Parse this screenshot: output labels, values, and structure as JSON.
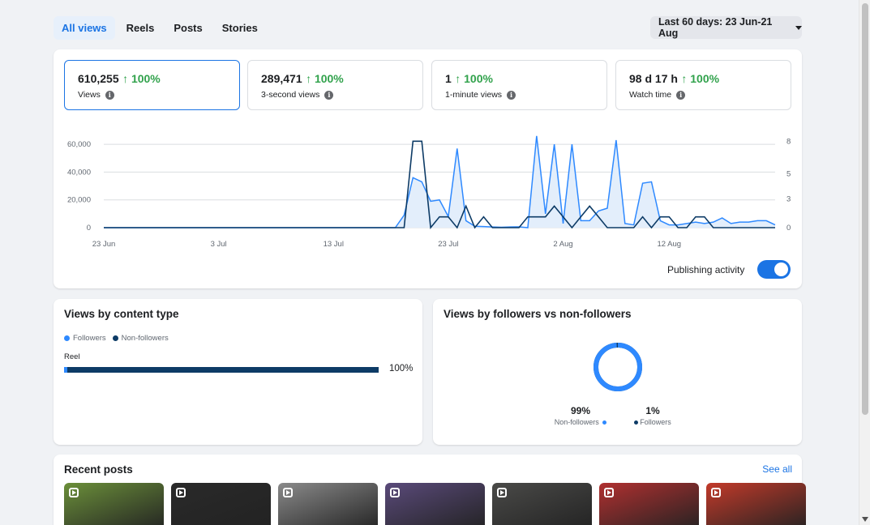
{
  "tabs": [
    {
      "label": "All views",
      "active": true
    },
    {
      "label": "Reels",
      "active": false
    },
    {
      "label": "Posts",
      "active": false
    },
    {
      "label": "Stories",
      "active": false
    }
  ],
  "date_range": "Last 60 days: 23 Jun-21 Aug",
  "metrics": [
    {
      "value": "610,255",
      "change": "↑ 100%",
      "label": "Views",
      "selected": true
    },
    {
      "value": "289,471",
      "change": "↑ 100%",
      "label": "3-second views",
      "selected": false
    },
    {
      "value": "1",
      "change": "↑ 100%",
      "label": "1-minute views",
      "selected": false
    },
    {
      "value": "98 d 17 h",
      "change": "↑ 100%",
      "label": "Watch time",
      "selected": false
    }
  ],
  "colors": {
    "accent": "#1b74e4",
    "positive": "#31a24c",
    "views_line": "#2e89ff",
    "activity_line": "#0d3b66",
    "area_fill": "#e3eefb"
  },
  "publishing_activity": {
    "label": "Publishing activity",
    "enabled": true
  },
  "chart_data": {
    "type": "line",
    "x": [
      "23 Jun",
      "24 Jun",
      "25 Jun",
      "26 Jun",
      "27 Jun",
      "28 Jun",
      "29 Jun",
      "30 Jun",
      "1 Jul",
      "2 Jul",
      "3 Jul",
      "4 Jul",
      "5 Jul",
      "6 Jul",
      "7 Jul",
      "8 Jul",
      "9 Jul",
      "10 Jul",
      "11 Jul",
      "12 Jul",
      "13 Jul",
      "14 Jul",
      "15 Jul",
      "16 Jul",
      "17 Jul",
      "18 Jul",
      "19 Jul",
      "20 Jul",
      "21 Jul",
      "22 Jul",
      "23 Jul",
      "24 Jul",
      "25 Jul",
      "26 Jul",
      "27 Jul",
      "28 Jul",
      "29 Jul",
      "30 Jul",
      "31 Jul",
      "1 Aug",
      "2 Aug",
      "3 Aug",
      "4 Aug",
      "5 Aug",
      "6 Aug",
      "7 Aug",
      "8 Aug",
      "9 Aug",
      "10 Aug",
      "11 Aug",
      "12 Aug",
      "13 Aug",
      "14 Aug",
      "15 Aug",
      "16 Aug",
      "17 Aug",
      "18 Aug",
      "19 Aug",
      "20 Aug",
      "21 Aug"
    ],
    "x_tick_labels": [
      "23 Jun",
      "3 Jul",
      "13 Jul",
      "23 Jul",
      "2 Aug",
      "12 Aug"
    ],
    "series": [
      {
        "name": "Views",
        "axis": "left",
        "values": [
          0,
          0,
          0,
          0,
          0,
          0,
          0,
          0,
          0,
          0,
          0,
          0,
          0,
          0,
          0,
          0,
          0,
          0,
          0,
          0,
          0,
          0,
          0,
          0,
          0,
          0,
          0,
          0,
          0,
          0,
          0,
          0,
          0,
          0,
          9000,
          36000,
          33000,
          19000,
          20000,
          8000,
          57000,
          5000,
          1000,
          800,
          500,
          300,
          500,
          600,
          0,
          66000,
          10000,
          60000,
          3000,
          60000,
          5000,
          5000,
          12000,
          14000,
          63000,
          3000,
          2000,
          32000,
          33000,
          5000,
          2000,
          2000,
          3000,
          4000,
          3000,
          4000,
          7000,
          3000,
          4000,
          4000,
          5000,
          5000,
          2000
        ]
      },
      {
        "name": "Publishing activity",
        "axis": "right",
        "values": [
          0,
          0,
          0,
          0,
          0,
          0,
          0,
          0,
          0,
          0,
          0,
          0,
          0,
          0,
          0,
          0,
          0,
          0,
          0,
          0,
          0,
          0,
          0,
          0,
          0,
          0,
          0,
          0,
          0,
          0,
          0,
          0,
          0,
          0,
          0,
          8,
          8,
          0,
          1,
          1,
          0,
          2,
          0,
          1,
          0,
          0,
          0,
          0,
          1,
          1,
          1,
          2,
          1,
          0,
          1,
          2,
          1,
          0,
          0,
          0,
          0,
          1,
          0,
          1,
          1,
          0,
          0,
          1,
          1,
          0,
          0,
          0,
          0,
          0,
          0,
          0,
          0
        ]
      }
    ],
    "y_left_ticks": [
      "0",
      "20,000",
      "40,000",
      "60,000"
    ],
    "y_right_ticks": [
      "0",
      "3",
      "5",
      "8"
    ],
    "ylim_left": [
      0,
      70000
    ],
    "ylim_right": [
      0,
      9
    ],
    "grid": true
  },
  "content_type": {
    "title": "Views by content type",
    "legend": [
      "Followers",
      "Non-followers"
    ],
    "rows": [
      {
        "label": "Reel",
        "followers_pct": 1,
        "percent_text": "100%"
      }
    ]
  },
  "followers_split": {
    "title": "Views by followers vs non-followers",
    "non_followers": {
      "pct": "99%",
      "label": "Non-followers",
      "value": 99
    },
    "followers": {
      "pct": "1%",
      "label": "Followers",
      "value": 1
    }
  },
  "recent_posts": {
    "title": "Recent posts",
    "see_all": "See all",
    "items": [
      {
        "icon": "reel-icon",
        "bg": "#6b8f3a"
      },
      {
        "icon": "reel-icon",
        "bg": "#2a2a2a"
      },
      {
        "icon": "reel-icon",
        "bg": "#8a8a8a"
      },
      {
        "icon": "reel-icon",
        "bg": "#5a4a7a"
      },
      {
        "icon": "reel-icon",
        "bg": "#4a4a48"
      },
      {
        "icon": "reel-icon",
        "bg": "#b03030"
      },
      {
        "icon": "reel-icon",
        "bg": "#c23a2a"
      }
    ]
  }
}
